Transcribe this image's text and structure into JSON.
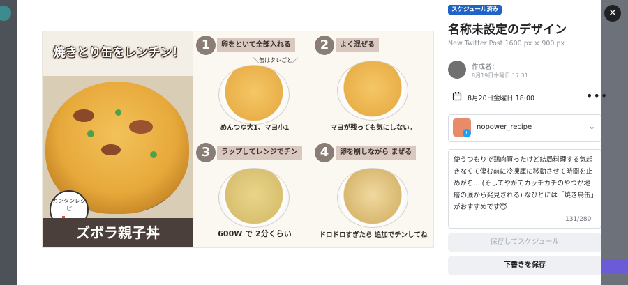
{
  "modal": {
    "status_badge": "スケジュール済み",
    "title": "名称未設定のデザイン",
    "subtitle": "New Twitter Post 1600 px × 900 px",
    "author_label": "作成者：",
    "author_date": "8月19日木曜日 17:31",
    "scheduled_date": "8月20日金曜日 18:00",
    "more_label": "•••",
    "account_name": "nopower_recipe",
    "post_text": "使うつもりで鶏肉買ったけど結局料理する気起きなくて傷む前に冷凍庫に移動させて時間を止めがち... (そしてやがてカッチカチのやつが地層の底から発見される) なひとには「焼き鳥缶」がおすすめです😇",
    "char_counter": "131/280",
    "schedule_button": "保存してスケジュール",
    "draft_button": "下書きを保存",
    "close_label": "✕"
  },
  "preview": {
    "headline": "焼きとり缶をレンチン！",
    "badge_text": "カンタンレシピ",
    "dish_name": "ズボラ親子丼",
    "note_top": "＼缶はタレごと／",
    "steps": [
      {
        "num": "1",
        "label": "卵をといて全部入れる",
        "caption": "めんつゆ大1、マヨ小1"
      },
      {
        "num": "2",
        "label": "よく混ぜる",
        "caption": "マヨが残っても気にしない。"
      },
      {
        "num": "3",
        "label": "ラップしてレンジでチン",
        "caption": "600W で 2分くらい"
      },
      {
        "num": "4",
        "label": "卵を崩しながら まぜる",
        "caption": "ドロドロすぎたら 追加でチンしてね"
      }
    ]
  },
  "colors": {
    "accent": "#1f63c6",
    "button_bg": "#eef0f3",
    "twitter": "#1da1f2"
  }
}
